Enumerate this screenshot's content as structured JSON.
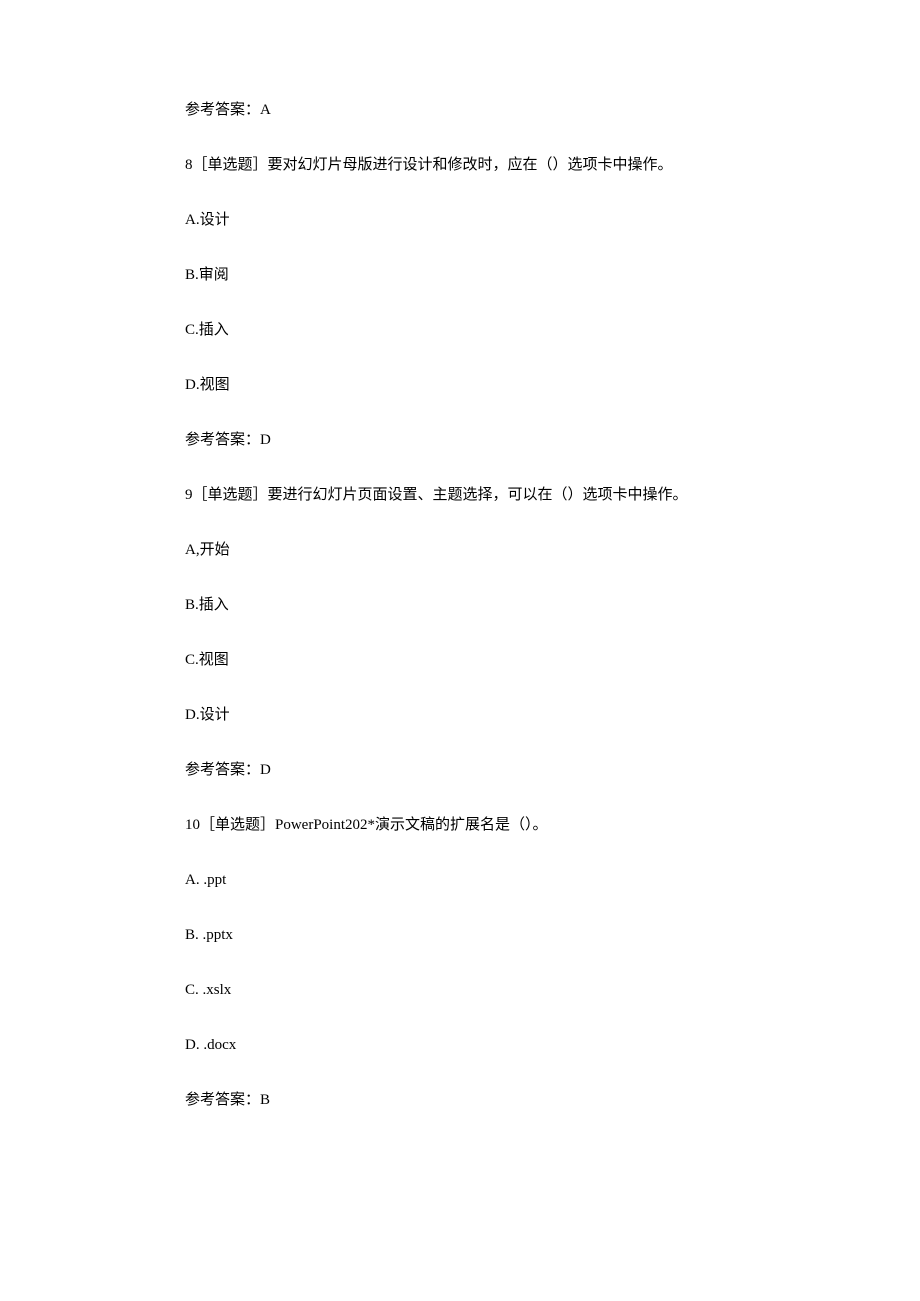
{
  "answer7": "参考答案：A",
  "q8": {
    "stem": "8［单选题］要对幻灯片母版进行设计和修改时，应在（）选项卡中操作。",
    "optA": "A.设计",
    "optB": "B.审阅",
    "optC": "C.插入",
    "optD": "D.视图",
    "answer": "参考答案：D"
  },
  "q9": {
    "stem": "9［单选题］要进行幻灯片页面设置、主题选择，可以在（）选项卡中操作。",
    "optA": "A,开始",
    "optB": "B.插入",
    "optC": "C.视图",
    "optD": "D.设计",
    "answer": "参考答案：D"
  },
  "q10": {
    "stem": "10［单选题］PowerPoint202*演示文稿的扩展名是（）。",
    "optA": "A. .ppt",
    "optB": "B. .pptx",
    "optC": "C. .xslx",
    "optD": "D. .docx",
    "answer": "参考答案：B"
  }
}
